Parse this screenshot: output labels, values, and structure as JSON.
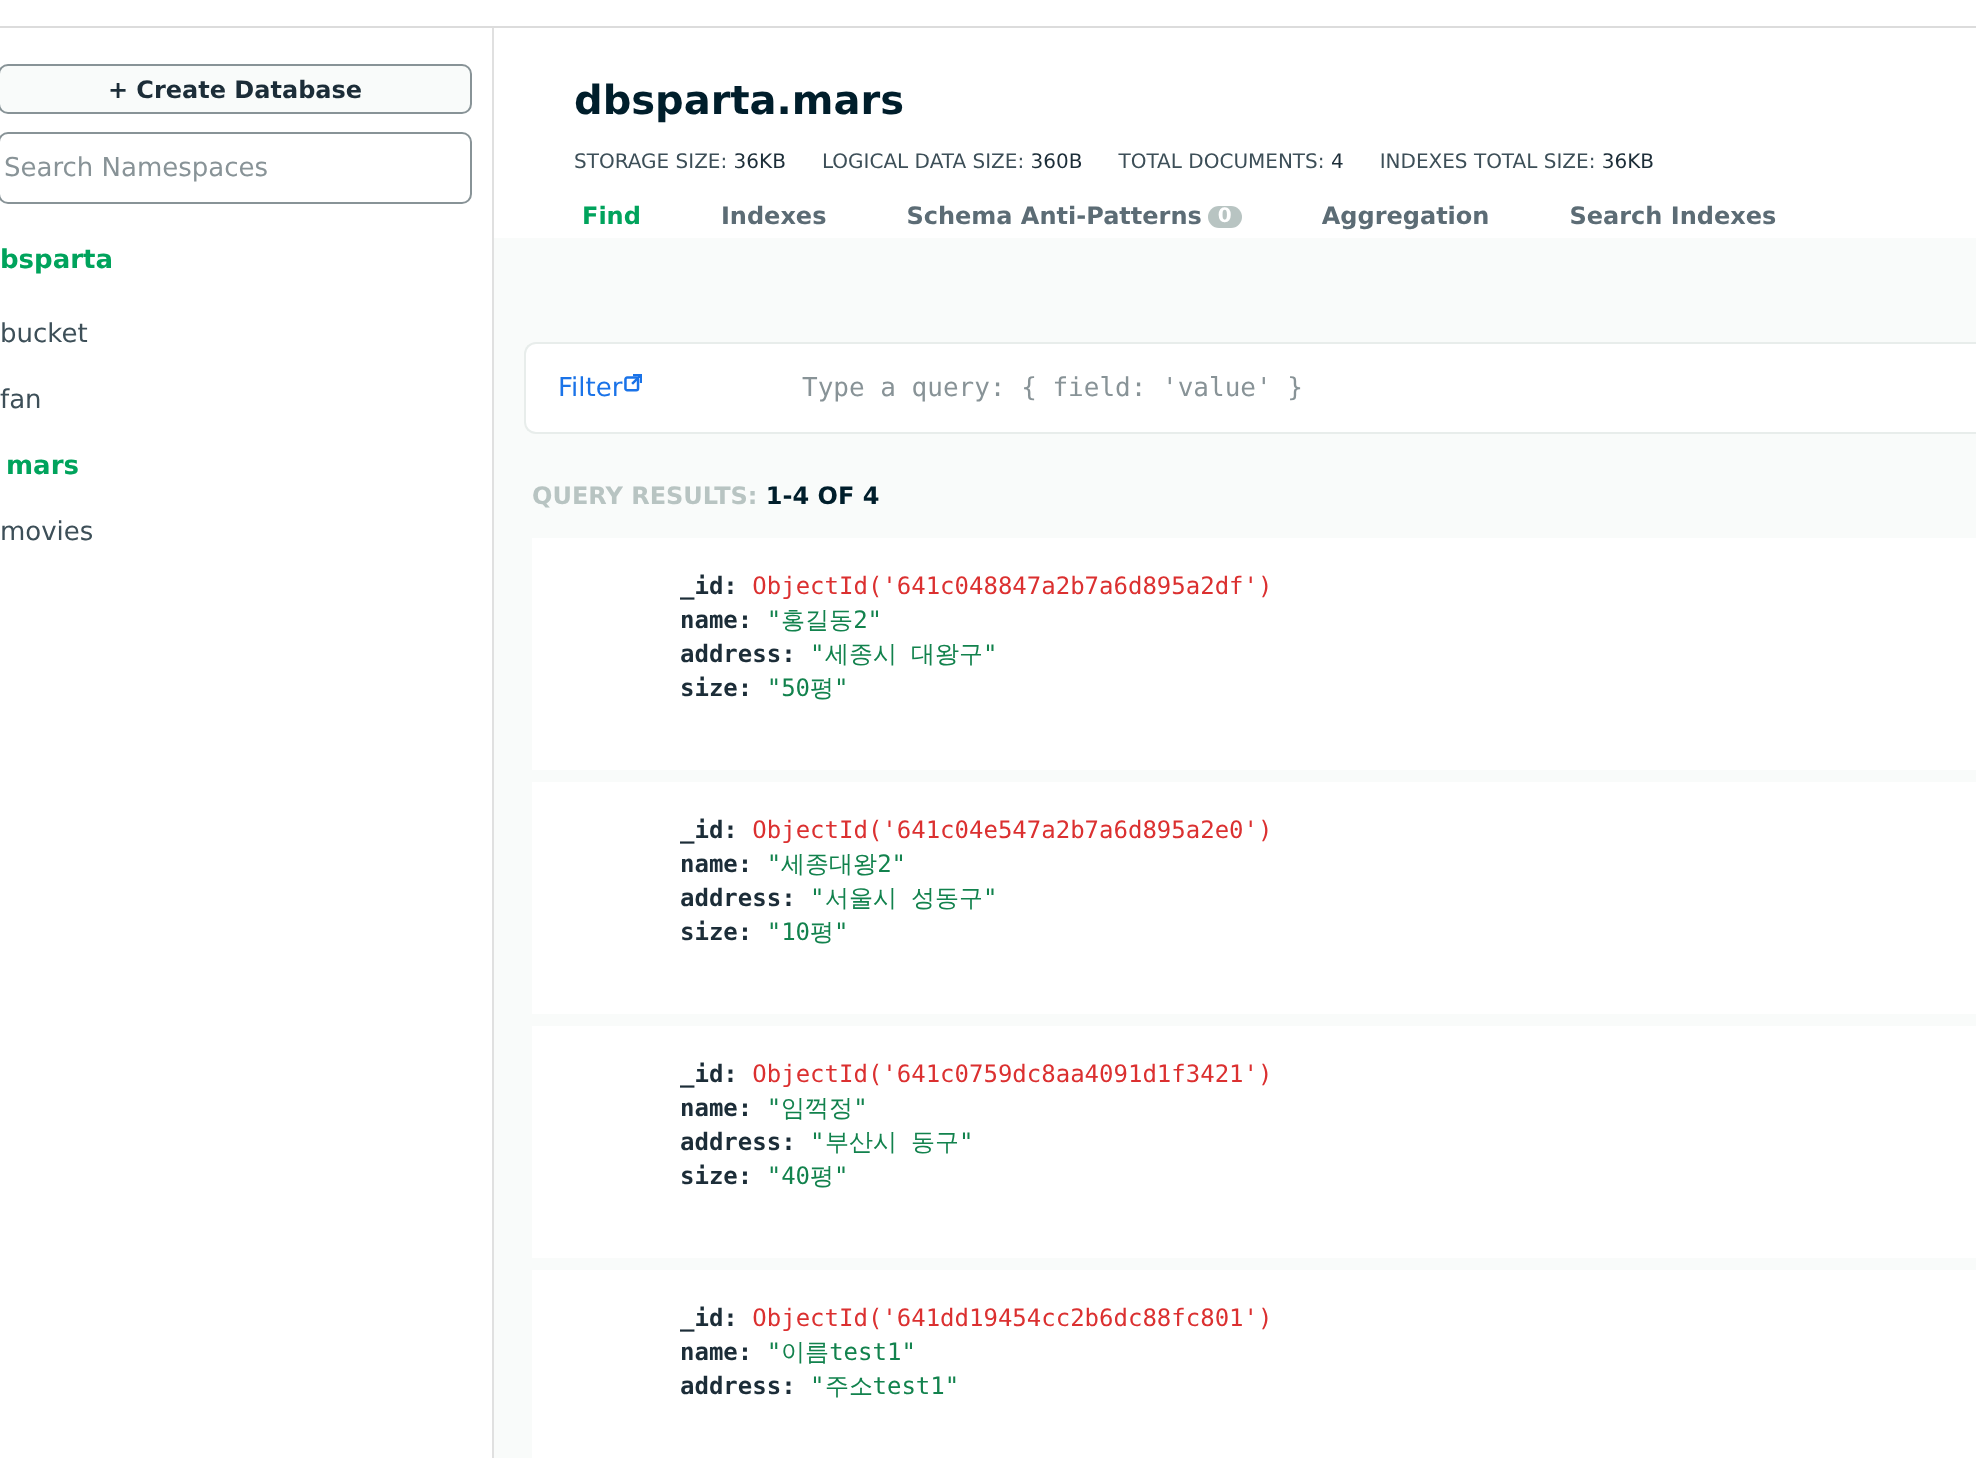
{
  "sidebar": {
    "create_button": "+ Create Database",
    "search": {
      "placeholder": "Search Namespaces"
    },
    "database": {
      "label": "bsparta"
    },
    "collections": [
      {
        "label": "bucket",
        "selected": false
      },
      {
        "label": "fan",
        "selected": false
      },
      {
        "label": "mars",
        "selected": true
      },
      {
        "label": "movies",
        "selected": false
      }
    ]
  },
  "title": "dbsparta.mars",
  "stats": [
    {
      "label": "STORAGE SIZE:",
      "value": "36KB"
    },
    {
      "label": "LOGICAL DATA SIZE:",
      "value": "360B"
    },
    {
      "label": "TOTAL DOCUMENTS:",
      "value": "4"
    },
    {
      "label": "INDEXES TOTAL SIZE:",
      "value": "36KB"
    }
  ],
  "tabs": [
    {
      "label": "Find",
      "selected": true
    },
    {
      "label": "Indexes",
      "selected": false
    },
    {
      "label": "Schema Anti-Patterns",
      "badge": "0",
      "selected": false
    },
    {
      "label": "Aggregation",
      "selected": false
    },
    {
      "label": "Search Indexes",
      "selected": false
    }
  ],
  "filter": {
    "label": "Filter",
    "placeholder": "Type a query: { field: 'value' }"
  },
  "query_results": {
    "label": "QUERY RESULTS:",
    "value": "1-4 OF 4"
  },
  "documents": [
    {
      "fields": [
        {
          "key": "_id:",
          "kind": "objectid",
          "value": "ObjectId('641c048847a2b7a6d895a2df')"
        },
        {
          "key": "name:",
          "kind": "string",
          "value": "\"홍길동2\""
        },
        {
          "key": "address:",
          "kind": "string",
          "value": "\"세종시 대왕구\""
        },
        {
          "key": "size:",
          "kind": "string",
          "value": "\"50평\""
        }
      ]
    },
    {
      "fields": [
        {
          "key": "_id:",
          "kind": "objectid",
          "value": "ObjectId('641c04e547a2b7a6d895a2e0')"
        },
        {
          "key": "name:",
          "kind": "string",
          "value": "\"세종대왕2\""
        },
        {
          "key": "address:",
          "kind": "string",
          "value": "\"서울시 성동구\""
        },
        {
          "key": "size:",
          "kind": "string",
          "value": "\"10평\""
        }
      ]
    },
    {
      "fields": [
        {
          "key": "_id:",
          "kind": "objectid",
          "value": "ObjectId('641c0759dc8aa4091d1f3421')"
        },
        {
          "key": "name:",
          "kind": "string",
          "value": "\"임꺽정\""
        },
        {
          "key": "address:",
          "kind": "string",
          "value": "\"부산시 동구\""
        },
        {
          "key": "size:",
          "kind": "string",
          "value": "\"40평\""
        }
      ]
    },
    {
      "fields": [
        {
          "key": "_id:",
          "kind": "objectid",
          "value": "ObjectId('641dd19454cc2b6dc88fc801')"
        },
        {
          "key": "name:",
          "kind": "string",
          "value": "\"이름test1\""
        },
        {
          "key": "address:",
          "kind": "string",
          "value": "\"주소test1\""
        }
      ]
    }
  ]
}
